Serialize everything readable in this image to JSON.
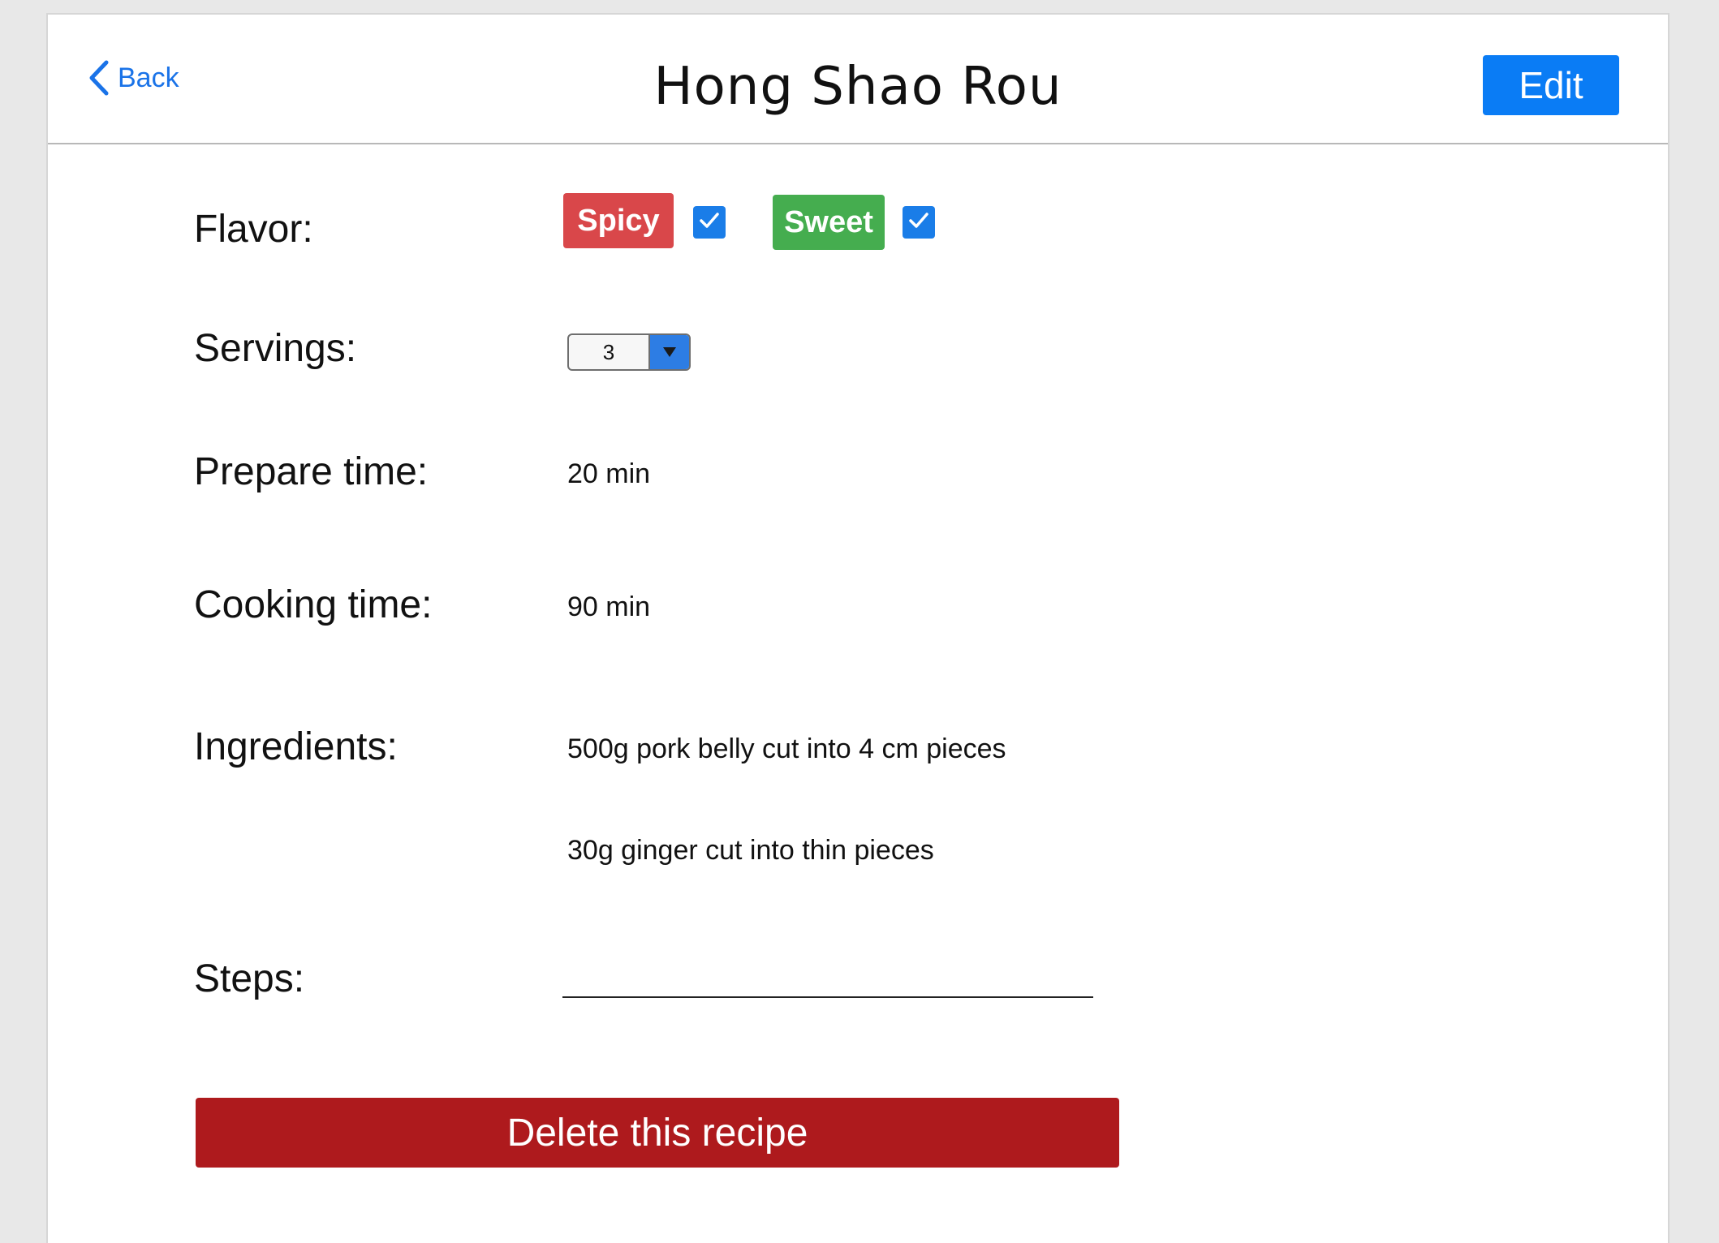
{
  "header": {
    "back_label": "Back",
    "title": "Hong Shao Rou",
    "edit_label": "Edit"
  },
  "flavor": {
    "label": "Flavor:",
    "tags": [
      {
        "label": "Spicy",
        "color": "#d9474a",
        "checked": true
      },
      {
        "label": "Sweet",
        "color": "#45ad4f",
        "checked": true
      }
    ]
  },
  "servings": {
    "label": "Servings:",
    "selected": "3"
  },
  "prepare_time": {
    "label": "Prepare time:",
    "value": "20 min"
  },
  "cooking_time": {
    "label": "Cooking time:",
    "value": "90 min"
  },
  "ingredients": {
    "label": "Ingredients:",
    "items": [
      "500g pork belly cut into 4 cm pieces",
      "30g ginger cut into thin pieces"
    ]
  },
  "steps": {
    "label": "Steps:"
  },
  "delete_label": "Delete this recipe",
  "colors": {
    "accent": "#0a7cf5",
    "danger": "#ae1a1d"
  },
  "icons": {
    "back": "chevron-left-icon",
    "checkbox": "check-icon",
    "dropdown": "triangle-down-icon"
  }
}
